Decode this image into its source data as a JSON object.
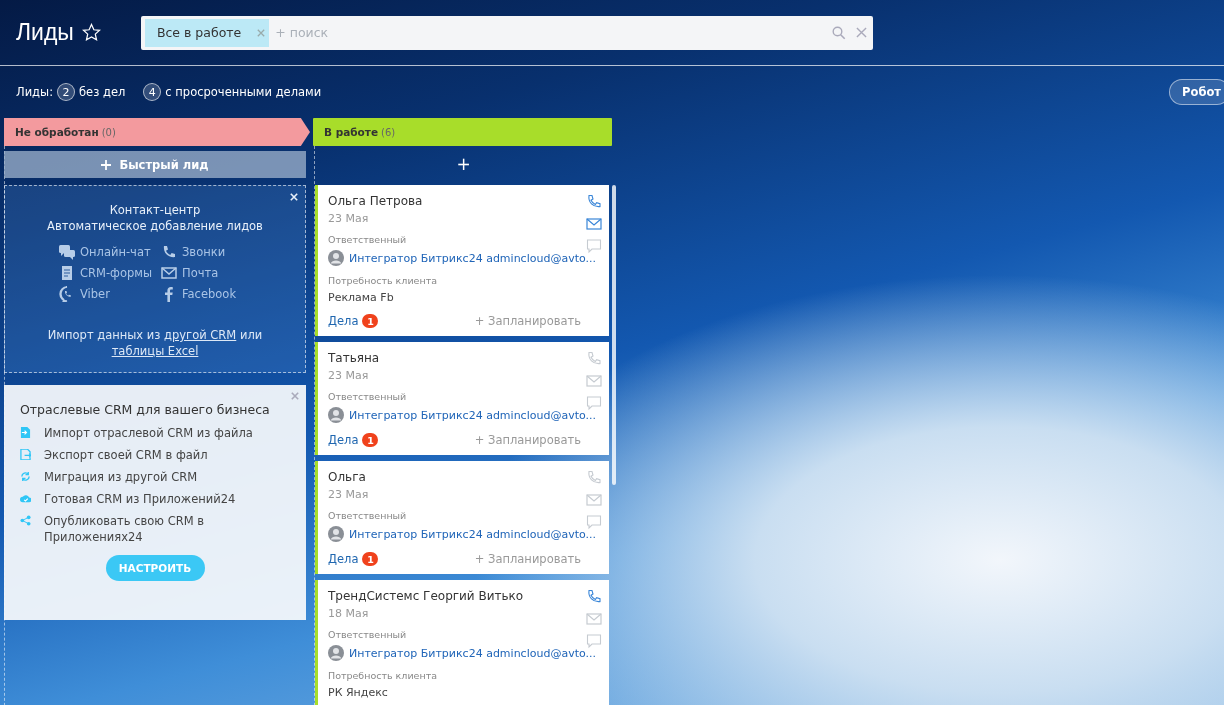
{
  "header": {
    "title": "Лиды",
    "filter": {
      "tag": "Все в работе",
      "placeholder": "+ поиск"
    }
  },
  "counters": {
    "label": "Лиды:",
    "items": [
      {
        "count": "2",
        "text": "без дел"
      },
      {
        "count": "4",
        "text": "с просроченными делами"
      }
    ]
  },
  "robots_button": "Робот",
  "columns": [
    {
      "kind": "arrow",
      "title": "Не обработан",
      "count": "(0)",
      "color": "#f39a9e",
      "quick_add": "Быстрый лид",
      "contact_center": {
        "title": "Контакт-центр",
        "subtitle": "Автоматическое добавление лидов",
        "channels": [
          "Онлайн-чат",
          "Звонки",
          "CRM-формы",
          "Почта",
          "Viber",
          "Facebook"
        ],
        "import_text": "Импорт данных из",
        "import_link": "другой CRM",
        "import_or": "или",
        "excel_link": "таблицы Excel"
      },
      "industry_crm": {
        "title": "Отраслевые CRM для вашего бизнеса",
        "items": [
          "Импорт отраслевой CRM из файла",
          "Экспорт своей CRM в файл",
          "Миграция из другой CRM",
          "Готовая CRM из Приложений24",
          "Опубликовать свою CRM в Приложениях24"
        ],
        "button": "НАСТРОИТЬ"
      }
    },
    {
      "kind": "flat",
      "title": "В работе",
      "count": "(6)",
      "color": "#a8dd2a",
      "add": "+",
      "cards": [
        {
          "name": "Ольга Петрова",
          "date": "23 Мая",
          "phone_active": true,
          "email_active": true,
          "responsible_label": "Ответственный",
          "responsible": "Интегратор Битрикс24 admincloud@avto...",
          "need_label": "Потребность клиента",
          "need": "Реклама Fb",
          "activities": "Дела",
          "activities_count": "1",
          "plan": "+ Запланировать"
        },
        {
          "name": "Татьяна",
          "date": "23 Мая",
          "phone_active": false,
          "email_active": false,
          "responsible_label": "Ответственный",
          "responsible": "Интегратор Битрикс24 admincloud@avto...",
          "activities": "Дела",
          "activities_count": "1",
          "plan": "+ Запланировать"
        },
        {
          "name": "Ольга",
          "date": "23 Мая",
          "phone_active": false,
          "email_active": false,
          "responsible_label": "Ответственный",
          "responsible": "Интегратор Битрикс24 admincloud@avto...",
          "activities": "Дела",
          "activities_count": "1",
          "plan": "+ Запланировать"
        },
        {
          "name": "ТрендСистемс Георгий Витько",
          "date": "18 Мая",
          "phone_active": true,
          "email_active": false,
          "responsible_label": "Ответственный",
          "responsible": "Интегратор Битрикс24 admincloud@avto...",
          "need_label": "Потребность клиента",
          "need": "РК Яндекс"
        }
      ]
    }
  ]
}
